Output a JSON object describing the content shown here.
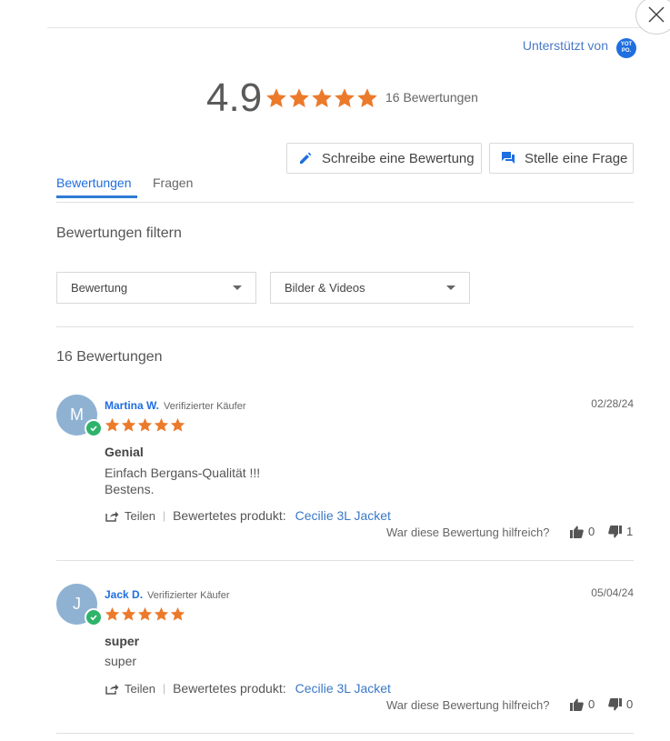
{
  "header": {
    "powered_by": "Unterstützt von",
    "logo_text": "YOT PO."
  },
  "summary": {
    "average": "4.9",
    "rating_value": 4.9,
    "rating_max": 5,
    "count_label": "16 Bewertungen"
  },
  "actions": {
    "write_review": "Schreibe eine Bewertung",
    "ask_question": "Stelle eine Frage"
  },
  "tabs": [
    {
      "label": "Bewertungen",
      "active": true
    },
    {
      "label": "Fragen",
      "active": false
    }
  ],
  "filters": {
    "title": "Bewertungen filtern",
    "rating_dropdown": "Bewertung",
    "media_dropdown": "Bilder & Videos"
  },
  "reviews_count": "16 Bewertungen",
  "reviews": [
    {
      "initial": "M",
      "name": "Martina W.",
      "badge": "Verifizierter Käufer",
      "date": "02/28/24",
      "stars": 5,
      "title": "Genial",
      "body_lines": [
        "Einfach Bergans-Qualität !!!",
        "Bestens."
      ],
      "share": "Teilen",
      "product_label": "Bewertetes produkt:",
      "product": "Cecilie 3L Jacket",
      "helpful": "War diese Bewertung hilfreich?",
      "up": "0",
      "down": "1"
    },
    {
      "initial": "J",
      "name": "Jack D.",
      "badge": "Verifizierter Käufer",
      "date": "05/04/24",
      "stars": 5,
      "title": "super",
      "body_lines": [
        "super"
      ],
      "share": "Teilen",
      "product_label": "Bewertetes produkt:",
      "product": "Cecilie 3L Jacket",
      "helpful": "War diese Bewertung hilfreich?",
      "up": "0",
      "down": "0"
    }
  ],
  "colors": {
    "accent": "#1f6fe0",
    "star": "#ec7a2b",
    "verified": "#2fb36b",
    "avatar": "#8fb2d3"
  }
}
